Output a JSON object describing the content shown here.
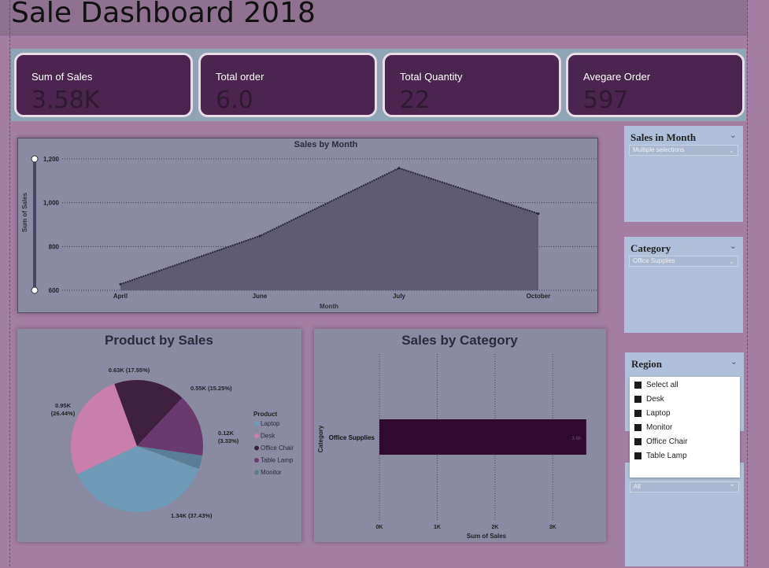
{
  "title": "Sale Dashboard 2018",
  "kpis": [
    {
      "label": "Sum of Sales",
      "value": "3.58K"
    },
    {
      "label": "Total order",
      "value": "6.0"
    },
    {
      "label": "Total Quantity",
      "value": "22"
    },
    {
      "label": "Avegare Order",
      "value": "597"
    }
  ],
  "colors": {
    "background": "#a27ea5",
    "kpi_card": "#4b244f",
    "area_fill": "#5e5a76",
    "bar_fill": "#2e0a33",
    "slicer_bg": "#b1c0da"
  },
  "slicers": {
    "month": {
      "title": "Sales in Month",
      "value": "Multiple selections"
    },
    "category": {
      "title": "Category",
      "value": "Office Supplies"
    },
    "region": {
      "title": "Region",
      "value": "All"
    },
    "dropdown_items": [
      "Select all",
      "Desk",
      "Laptop",
      "Monitor",
      "Office Chair",
      "Table Lamp"
    ]
  },
  "chart_data": [
    {
      "type": "area",
      "title": "Sales by Month",
      "xlabel": "Month",
      "ylabel": "Sum of Sales",
      "categories": [
        "April",
        "June",
        "July",
        "October"
      ],
      "values": [
        628,
        848,
        1158,
        950
      ],
      "yticks": [
        "600",
        "800",
        "1,000",
        "1,200"
      ],
      "ylim": [
        600,
        1200
      ],
      "grid": true
    },
    {
      "type": "pie",
      "title": "Product by Sales",
      "legend_title": "Product",
      "slices": [
        {
          "name": "Laptop",
          "value": 1.34,
          "label": "1.34K (37.43%)",
          "color": "#6f9ab8"
        },
        {
          "name": "Desk",
          "value": 0.95,
          "label": "0.95K (26.44%)",
          "color": "#c97fab"
        },
        {
          "name": "Office Chair",
          "value": 0.63,
          "label": "0.63K (17.55%)",
          "color": "#40203f"
        },
        {
          "name": "Table Lamp",
          "value": 0.55,
          "label": "0.55K (15.25%)",
          "color": "#6a3a6e"
        },
        {
          "name": "Monitor",
          "value": 0.12,
          "label": "0.12K (3.33%)",
          "color": "#5a7e95"
        }
      ],
      "legend_placement": "right"
    },
    {
      "type": "bar",
      "orientation": "horizontal",
      "title": "Sales by Category",
      "xlabel": "Sum of Sales",
      "ylabel": "Category",
      "categories": [
        "Office Supplies"
      ],
      "values": [
        3.58
      ],
      "data_labels": [
        "3.6K"
      ],
      "xticks": [
        "0K",
        "1K",
        "2K",
        "3K"
      ],
      "xlim": [
        0,
        3.8
      ],
      "grid": true
    }
  ]
}
